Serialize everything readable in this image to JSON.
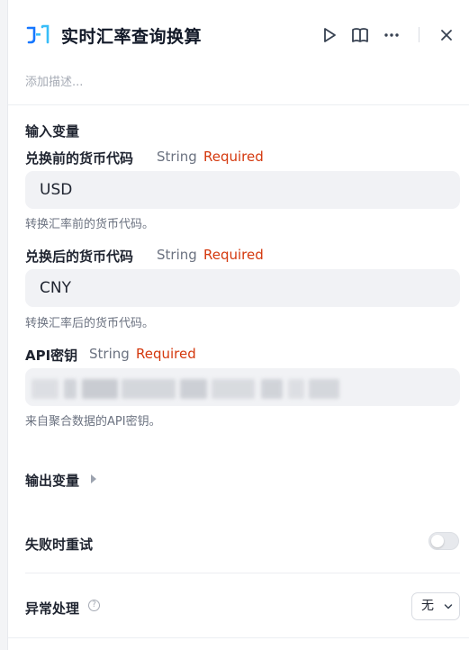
{
  "header": {
    "title": "实时汇率查询换算",
    "logo_icon": "jf-logo-icon",
    "description_placeholder": "添加描述..."
  },
  "toolbar": {
    "run_icon": "play-icon",
    "docs_icon": "book-icon",
    "more_icon": "more-horizontal-icon",
    "close_icon": "close-icon"
  },
  "inputs": {
    "section_title": "输入变量",
    "fields": [
      {
        "label": "兑换前的货币代码",
        "type": "String",
        "required": "Required",
        "value": "USD",
        "help": "转换汇率前的货币代码。"
      },
      {
        "label": "兑换后的货币代码",
        "type": "String",
        "required": "Required",
        "value": "CNY",
        "help": "转换汇率后的货币代码。"
      },
      {
        "label": "API密钥",
        "type": "String",
        "required": "Required",
        "value": "",
        "help": "来自聚合数据的API密钥。"
      }
    ]
  },
  "outputs": {
    "section_title": "输出变量"
  },
  "retry": {
    "label": "失败时重试",
    "enabled": false
  },
  "error_handling": {
    "label": "异常处理",
    "selected": "无"
  },
  "colors": {
    "brand": "#1677ff",
    "required": "#d4380d",
    "input_bg": "#f1f2f5"
  }
}
